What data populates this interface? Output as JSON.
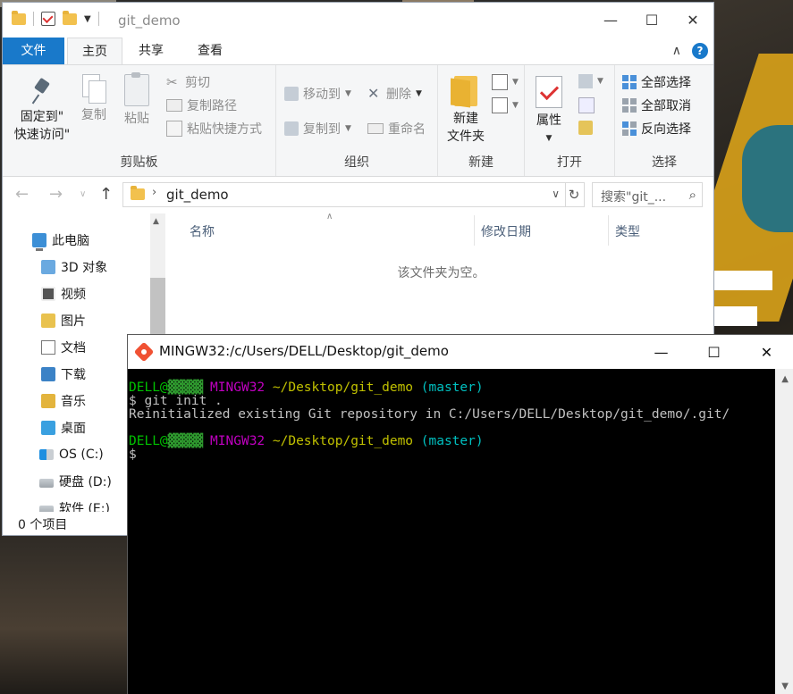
{
  "explorer": {
    "title": "git_demo",
    "tabs": {
      "file": "文件",
      "home": "主页",
      "share": "共享",
      "view": "查看"
    },
    "ribbon": {
      "clipboard": {
        "label": "剪贴板",
        "pin_line1": "固定到\"",
        "pin_line2": "快速访问\"",
        "copy": "复制",
        "paste": "粘贴",
        "cut": "剪切",
        "copy_path": "复制路径",
        "paste_shortcut": "粘贴快捷方式"
      },
      "organize": {
        "label": "组织",
        "move_to": "移动到",
        "copy_to": "复制到",
        "delete": "删除",
        "rename": "重命名"
      },
      "new": {
        "label": "新建",
        "new_folder_line1": "新建",
        "new_folder_line2": "文件夹"
      },
      "open": {
        "label": "打开",
        "properties": "属性"
      },
      "select": {
        "label": "选择",
        "select_all": "全部选择",
        "select_none": "全部取消",
        "invert": "反向选择"
      }
    },
    "address": {
      "path": "git_demo",
      "search_placeholder": "搜索\"git_..."
    },
    "sidebar": {
      "items": [
        {
          "label": "此电脑",
          "icon": "pc-icon"
        },
        {
          "label": "3D 对象",
          "icon": "3d-objects-icon"
        },
        {
          "label": "视频",
          "icon": "videos-icon"
        },
        {
          "label": "图片",
          "icon": "pictures-icon"
        },
        {
          "label": "文档",
          "icon": "documents-icon"
        },
        {
          "label": "下载",
          "icon": "downloads-icon"
        },
        {
          "label": "音乐",
          "icon": "music-icon"
        },
        {
          "label": "桌面",
          "icon": "desktop-icon"
        },
        {
          "label": "OS (C:)",
          "icon": "drive-c-icon"
        },
        {
          "label": "硬盘 (D:)",
          "icon": "drive-d-icon"
        },
        {
          "label": "软件 (E:)",
          "icon": "drive-e-icon"
        }
      ]
    },
    "columns": {
      "name": "名称",
      "modified": "修改日期",
      "type": "类型"
    },
    "empty_message": "该文件夹为空。",
    "status": "0 个项目"
  },
  "terminal": {
    "title": "MINGW32:/c/Users/DELL/Desktop/git_demo",
    "user": "DELL@",
    "host_redacted": "▓▓▓▓▓",
    "env": "MINGW32",
    "cwd": "~/Desktop/git_demo",
    "branch": "(master)",
    "command": "$ git init .",
    "output": "Reinitialized existing Git repository in C:/Users/DELL/Desktop/git_demo/.git/",
    "prompt": "$"
  },
  "colors": {
    "accent": "#1979ca",
    "term_green": "#00c000",
    "term_magenta": "#c000c0",
    "term_yellow": "#c0c000",
    "term_cyan": "#00c0c0"
  }
}
